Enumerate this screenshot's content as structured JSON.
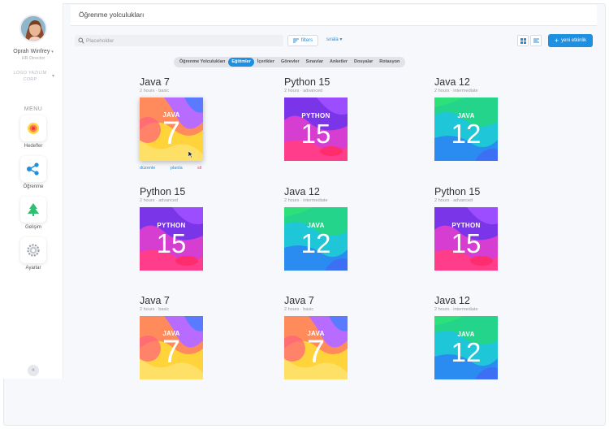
{
  "user": {
    "name": "Oprah Winfrey",
    "role": "HR Director"
  },
  "company": "LOGO YAZILIM CORP",
  "menu": {
    "title": "MENU",
    "items": [
      {
        "label": "Hedefler",
        "icon": "target-icon"
      },
      {
        "label": "Öğrenme",
        "icon": "learning-nodes-icon"
      },
      {
        "label": "Gelişim",
        "icon": "tree-icon"
      },
      {
        "label": "Ayarlar",
        "icon": "gear-icon"
      }
    ],
    "collapse": "«"
  },
  "header": {
    "title": "Öğrenme yolculukları"
  },
  "toolbar": {
    "search_placeholder": "Placeholder",
    "filters_label": "filters",
    "sort_label": "sırala",
    "new_label": "yeni etkinlik"
  },
  "tabs": [
    {
      "label": "Öğrenme Yolculukları",
      "active": false
    },
    {
      "label": "Eğitimler",
      "active": true
    },
    {
      "label": "İçerikler",
      "active": false
    },
    {
      "label": "Görevler",
      "active": false
    },
    {
      "label": "Sınavlar",
      "active": false
    },
    {
      "label": "Anketler",
      "active": false
    },
    {
      "label": "Dosyalar",
      "active": false
    },
    {
      "label": "Rotasyon",
      "active": false
    }
  ],
  "card_actions": {
    "edit": "düzenle",
    "plan": "planla",
    "delete": "sil"
  },
  "cards": [
    {
      "title": "Java 7",
      "meta": "2 hours · basic",
      "lang": "JAVA",
      "num": "7",
      "theme": "java7"
    },
    {
      "title": "Python 15",
      "meta": "2 hours · advanced",
      "lang": "PYTHON",
      "num": "15",
      "theme": "python"
    },
    {
      "title": "Java 12",
      "meta": "2 hours · intermediate",
      "lang": "JAVA",
      "num": "12",
      "theme": "java12"
    },
    {
      "title": "Python 15",
      "meta": "2 hours · advanced",
      "lang": "PYTHON",
      "num": "15",
      "theme": "python"
    },
    {
      "title": "Java 12",
      "meta": "2 hours · intermediate",
      "lang": "JAVA",
      "num": "12",
      "theme": "java12"
    },
    {
      "title": "Python 15",
      "meta": "2 hours · advanced",
      "lang": "PYTHON",
      "num": "15",
      "theme": "python"
    },
    {
      "title": "Java 7",
      "meta": "2 hours · basic",
      "lang": "JAVA",
      "num": "7",
      "theme": "java7"
    },
    {
      "title": "Java 7",
      "meta": "2 hours · basic",
      "lang": "JAVA",
      "num": "7",
      "theme": "java7"
    },
    {
      "title": "Java 12",
      "meta": "2 hours · intermediate",
      "lang": "JAVA",
      "num": "12",
      "theme": "java12"
    }
  ],
  "colors": {
    "accent": "#1f8fe0",
    "delete": "#e83e6c"
  }
}
